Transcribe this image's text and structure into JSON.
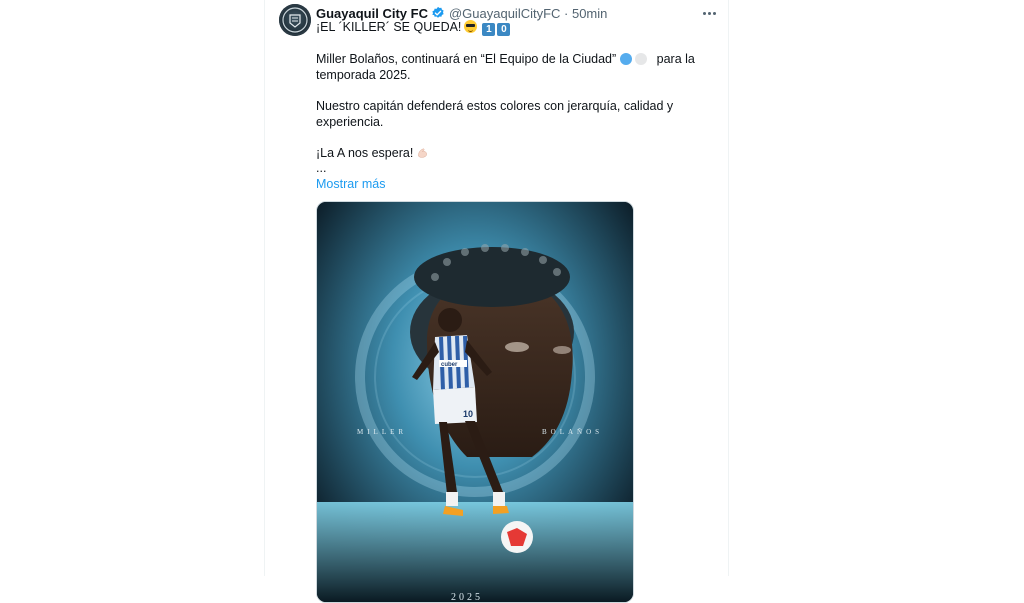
{
  "tweet": {
    "author_name": "Guayaquil City FC",
    "handle_time": "@GuayaquilCityFC · 50min",
    "lines": [
      "¡EL ´KILLER´ SE QUEDA!",
      "Miller Bolaños, continuará en “El Equipo de la Ciudad”",
      "para la",
      "temporada  2025.",
      "Nuestro capitán defenderá estos colores con jerarquía, calidad y",
      "experiencia.",
      "¡La A nos espera!",
      "..."
    ],
    "keycaps": [
      "1",
      "0"
    ],
    "show_more": "Mostrar más"
  },
  "media": {
    "overlay_left": "MILLER",
    "overlay_right": "BOLAÑOS",
    "bottom_text": "2025",
    "jersey_number": "10",
    "jersey_sponsor": "cuber"
  },
  "icons": {
    "verified": "verified-badge-icon",
    "more": "more-options-icon",
    "avatar": "club-crest-avatar"
  },
  "colors": {
    "link": "#1d9bf0",
    "verified": "#1d9bf0",
    "secondary_text": "#536471"
  }
}
